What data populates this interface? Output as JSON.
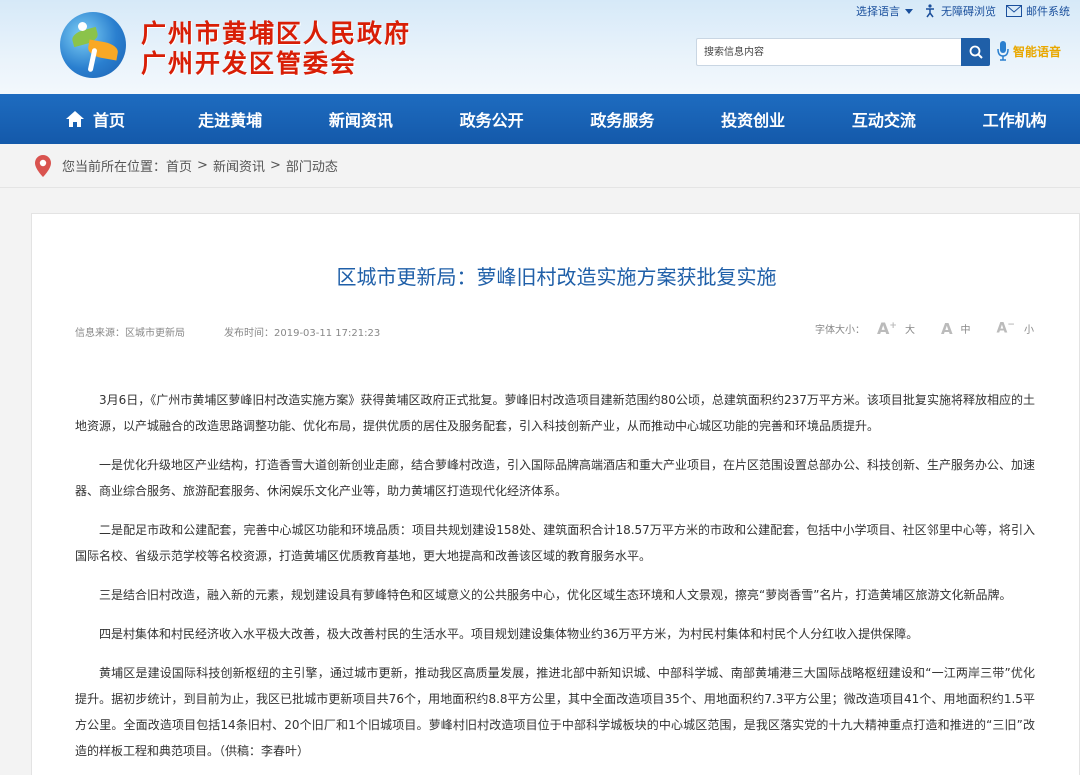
{
  "site": {
    "title_line1": "广州市黄埔区人民政府",
    "title_line2": "广州开发区管委会"
  },
  "top_links": {
    "language": "选择语言",
    "accessibility": "无障碍浏览",
    "mail": "邮件系统"
  },
  "search": {
    "placeholder": "搜索信息内容",
    "voice_label": "智能语音"
  },
  "nav": {
    "items": [
      "首页",
      "走进黄埔",
      "新闻资讯",
      "政务公开",
      "政务服务",
      "投资创业",
      "互动交流",
      "工作机构"
    ]
  },
  "breadcrumb": {
    "prefix": "您当前所在位置：",
    "items": [
      "首页",
      "新闻资讯",
      "部门动态"
    ],
    "separator": ">"
  },
  "article": {
    "title": "区城市更新局：萝峰旧村改造实施方案获批复实施",
    "source": "信息来源：区城市更新局",
    "date": "发布时间：2019-03-11 17:21:23",
    "font_size_label": "字体大小：",
    "font_large": "大",
    "font_medium": "中",
    "font_small": "小",
    "paragraphs": [
      "3月6日，《广州市黄埔区萝峰旧村改造实施方案》获得黄埔区政府正式批复。萝峰旧村改造项目建新范围约80公顷，总建筑面积约237万平方米。该项目批复实施将释放相应的土地资源，以产城融合的改造思路调整功能、优化布局，提供优质的居住及服务配套，引入科技创新产业，从而推动中心城区功能的完善和环境品质提升。",
      "一是优化升级地区产业结构，打造香雪大道创新创业走廊，结合萝峰村改造，引入国际品牌高端酒店和重大产业项目，在片区范围设置总部办公、科技创新、生产服务办公、加速器、商业综合服务、旅游配套服务、休闲娱乐文化产业等，助力黄埔区打造现代化经济体系。",
      "二是配足市政和公建配套，完善中心城区功能和环境品质：项目共规划建设158处、建筑面积合计18.57万平方米的市政和公建配套，包括中小学项目、社区邻里中心等，将引入国际名校、省级示范学校等名校资源，打造黄埔区优质教育基地，更大地提高和改善该区域的教育服务水平。",
      "三是结合旧村改造，融入新的元素，规划建设具有萝峰特色和区域意义的公共服务中心，优化区域生态环境和人文景观，擦亮“萝岗香雪”名片，打造黄埔区旅游文化新品牌。",
      "四是村集体和村民经济收入水平极大改善，极大改善村民的生活水平。项目规划建设集体物业约36万平方米，为村民村集体和村民个人分红收入提供保障。",
      "黄埔区是建设国际科技创新枢纽的主引擎，通过城市更新，推动我区高质量发展，推进北部中新知识城、中部科学城、南部黄埔港三大国际战略枢纽建设和“一江两岸三带”优化提升。据初步统计，到目前为止，我区已批城市更新项目共76个，用地面积约8.8平方公里，其中全面改造项目35个、用地面积约7.3平方公里；微改造项目41个、用地面积约1.5平方公里。全面改造项目包括14条旧村、20个旧厂和1个旧城项目。萝峰村旧村改造项目位于中部科学城板块的中心城区范围，是我区落实党的十九大精神重点打造和推进的“三旧”改造的样板工程和典范项目。（供稿：李春叶）"
    ]
  },
  "colors": {
    "nav_bg": "#1a62b5",
    "title_red": "#d81e06",
    "article_title_blue": "#1f5fa8",
    "voice_orange": "#e9a800"
  }
}
